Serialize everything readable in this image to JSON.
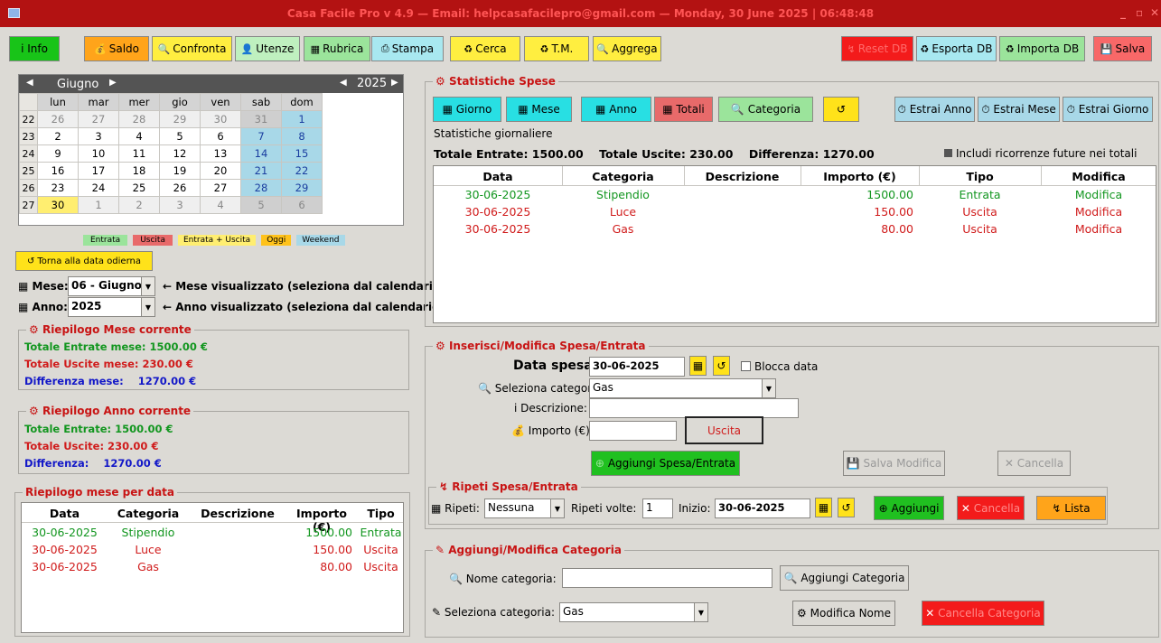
{
  "window": {
    "title": "Casa Facile Pro v 4.9  — Email: helpcasafacilepro@gmail.com —  Monday, 30 June 2025 | 06:48:48"
  },
  "toolbar": {
    "info": "i Info",
    "saldo": "Saldo",
    "confronta": "Confronta",
    "utenze": "Utenze",
    "rubrica": "Rubrica",
    "stampa": "Stampa",
    "cerca": "Cerca",
    "tm": "T.M.",
    "aggrega": "Aggrega",
    "reset": "Reset DB",
    "esporta": "Esporta DB",
    "importa": "Importa DB",
    "salva": "Salva"
  },
  "calendar": {
    "month": "Giugno",
    "year": "2025",
    "days": [
      "lun",
      "mar",
      "mer",
      "gio",
      "ven",
      "sab",
      "dom"
    ],
    "weeks": [
      {
        "n": "22",
        "d": [
          "26",
          "27",
          "28",
          "29",
          "30",
          "31",
          "1"
        ]
      },
      {
        "n": "23",
        "d": [
          "2",
          "3",
          "4",
          "5",
          "6",
          "7",
          "8"
        ]
      },
      {
        "n": "24",
        "d": [
          "9",
          "10",
          "11",
          "12",
          "13",
          "14",
          "15"
        ]
      },
      {
        "n": "25",
        "d": [
          "16",
          "17",
          "18",
          "19",
          "20",
          "21",
          "22"
        ]
      },
      {
        "n": "26",
        "d": [
          "23",
          "24",
          "25",
          "26",
          "27",
          "28",
          "29"
        ]
      },
      {
        "n": "27",
        "d": [
          "30",
          "1",
          "2",
          "3",
          "4",
          "5",
          "6"
        ]
      }
    ]
  },
  "legend": {
    "entrata": "Entrata",
    "uscita": "Uscita",
    "both": "Entrata + Uscita",
    "oggi": "Oggi",
    "weekend": "Weekend"
  },
  "torna": "Torna alla data odierna",
  "mese": {
    "label": "Mese:",
    "value": "06 - Giugno",
    "hint": "← Mese visualizzato (seleziona dal calendario)"
  },
  "anno": {
    "label": "Anno:",
    "value": "2025",
    "hint": "← Anno visualizzato (seleziona dal calendario)"
  },
  "riep_mese": {
    "title": "Riepilogo Mese corrente",
    "entrate": "Totale Entrate mese: 1500.00 €",
    "uscite": "Totale Uscite mese:  230.00 €",
    "diff_label": "Differenza mese:",
    "diff_value": "1270.00 €"
  },
  "riep_anno": {
    "title": "Riepilogo Anno corrente",
    "entrate": "Totale Entrate: 1500.00 €",
    "uscite": "Totale Uscite:  230.00 €",
    "diff_label": "Differenza:",
    "diff_value": "1270.00 €"
  },
  "riep_data": {
    "title": "Riepilogo mese per data",
    "cols": [
      "Data",
      "Categoria",
      "Descrizione",
      "Importo (€)",
      "Tipo"
    ],
    "rows": [
      {
        "data": "30-06-2025",
        "cat": "Stipendio",
        "desc": "",
        "imp": "1500.00",
        "tipo": "Entrata"
      },
      {
        "data": "30-06-2025",
        "cat": "Luce",
        "desc": "",
        "imp": "150.00",
        "tipo": "Uscita"
      },
      {
        "data": "30-06-2025",
        "cat": "Gas",
        "desc": "",
        "imp": "80.00",
        "tipo": "Uscita"
      }
    ]
  },
  "stat": {
    "title": "Statistiche Spese",
    "buttons": {
      "giorno": "Giorno",
      "mese": "Mese",
      "anno": "Anno",
      "totali": "Totali",
      "categoria": "Categoria",
      "refresh": "↺",
      "estrai_anno": "Estrai Anno",
      "estrai_mese": "Estrai Mese",
      "estrai_giorno": "Estrai Giorno"
    },
    "subtitle": "Statistiche giornaliere",
    "totals": "Totale Entrate: 1500.00    Totale Uscite: 230.00    Differenza: 1270.00",
    "includi": "Includi ricorrenze future nei totali",
    "cols": [
      "Data",
      "Categoria",
      "Descrizione",
      "Importo (€)",
      "Tipo",
      "Modifica"
    ],
    "rows": [
      {
        "data": "30-06-2025",
        "cat": "Stipendio",
        "desc": "",
        "imp": "1500.00",
        "tipo": "Entrata",
        "mod": "Modifica"
      },
      {
        "data": "30-06-2025",
        "cat": "Luce",
        "desc": "",
        "imp": "150.00",
        "tipo": "Uscita",
        "mod": "Modifica"
      },
      {
        "data": "30-06-2025",
        "cat": "Gas",
        "desc": "",
        "imp": "80.00",
        "tipo": "Uscita",
        "mod": "Modifica"
      }
    ]
  },
  "ins": {
    "title": "Inserisci/Modifica Spesa/Entrata",
    "data_label": "Data spesa:",
    "data_value": "30-06-2025",
    "blocca": "Blocca data",
    "cat_label": "Seleziona categoria:",
    "cat_value": "Gas",
    "desc_label": "i Descrizione:",
    "desc_value": "",
    "imp_label": "Importo (€):",
    "imp_value": "",
    "tipo": "Uscita",
    "aggiungi": "Aggiungi Spesa/Entrata",
    "salva_mod": "Salva Modifica",
    "cancella": "Cancella"
  },
  "ripeti": {
    "title": "Ripeti Spesa/Entrata",
    "label": "Ripeti:",
    "value": "Nessuna",
    "volte_label": "Ripeti volte:",
    "volte": "1",
    "inizio_label": "Inizio:",
    "inizio": "30-06-2025",
    "aggiungi": "Aggiungi",
    "cancella": "Cancella",
    "lista": "Lista"
  },
  "cat": {
    "title": "Aggiungi/Modifica Categoria",
    "nome_label": "Nome categoria:",
    "nome_value": "",
    "aggiungi": "Aggiungi Categoria",
    "sel_label": "Seleziona categoria:",
    "sel_value": "Gas",
    "modifica": "Modifica Nome",
    "cancella": "Cancella Categoria"
  }
}
